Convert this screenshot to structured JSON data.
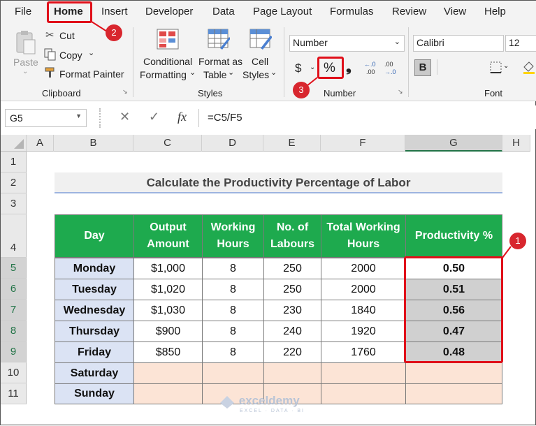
{
  "menu": {
    "file": "File",
    "home": "Home",
    "insert": "Insert",
    "developer": "Developer",
    "data": "Data",
    "page_layout": "Page Layout",
    "formulas": "Formulas",
    "review": "Review",
    "view": "View",
    "help": "Help"
  },
  "clipboard": {
    "paste": "Paste",
    "cut": "Cut",
    "copy": "Copy",
    "format_painter": "Format Painter",
    "group_label": "Clipboard"
  },
  "styles": {
    "conditional_1": "Conditional",
    "conditional_2": "Formatting",
    "format_table_1": "Format as",
    "format_table_2": "Table",
    "cell_styles_1": "Cell",
    "cell_styles_2": "Styles",
    "group_label": "Styles"
  },
  "number": {
    "format": "Number",
    "currency": "$",
    "percent": "%",
    "comma": "❟",
    "group_label": "Number"
  },
  "font": {
    "name": "Calibri",
    "size": "12",
    "bold": "B",
    "group_label": "Font"
  },
  "formula_bar": {
    "name_box": "G5",
    "cancel": "✕",
    "enter": "✓",
    "fx": "fx",
    "formula": "=C5/F5"
  },
  "columns": [
    "A",
    "B",
    "C",
    "D",
    "E",
    "F",
    "G",
    "H"
  ],
  "rows": [
    "1",
    "2",
    "3",
    "4",
    "5",
    "6",
    "7",
    "8",
    "9",
    "10",
    "11"
  ],
  "sheet": {
    "title": "Calculate the Productivity Percentage of Labor",
    "headers": {
      "day": "Day",
      "output_1": "Output",
      "output_2": "Amount",
      "working_1": "Working",
      "working_2": "Hours",
      "labours_1": "No. of",
      "labours_2": "Labours",
      "total_1": "Total Working",
      "total_2": "Hours",
      "productivity": "Productivity %"
    },
    "table": [
      {
        "day": "Monday",
        "output": "$1,000",
        "hours": "8",
        "labours": "250",
        "total": "2000",
        "productivity": "0.50"
      },
      {
        "day": "Tuesday",
        "output": "$1,020",
        "hours": "8",
        "labours": "250",
        "total": "2000",
        "productivity": "0.51"
      },
      {
        "day": "Wednesday",
        "output": "$1,030",
        "hours": "8",
        "labours": "230",
        "total": "1840",
        "productivity": "0.56"
      },
      {
        "day": "Thursday",
        "output": "$900",
        "hours": "8",
        "labours": "240",
        "total": "1920",
        "productivity": "0.47"
      },
      {
        "day": "Friday",
        "output": "$850",
        "hours": "8",
        "labours": "220",
        "total": "1760",
        "productivity": "0.48"
      },
      {
        "day": "Saturday",
        "output": "",
        "hours": "",
        "labours": "",
        "total": "",
        "productivity": ""
      },
      {
        "day": "Sunday",
        "output": "",
        "hours": "",
        "labours": "",
        "total": "",
        "productivity": ""
      }
    ]
  },
  "callouts": {
    "one": "1",
    "two": "2",
    "three": "3"
  },
  "watermark": {
    "name": "exceldemy",
    "tagline": "EXCEL · DATA · BI"
  },
  "colors": {
    "header_green": "#1eaa4e",
    "day_blue": "#dbe3f4",
    "selection_gray": "#d0d0d0",
    "empty_peach": "#fce4d6",
    "callout_red": "#e0101a"
  }
}
